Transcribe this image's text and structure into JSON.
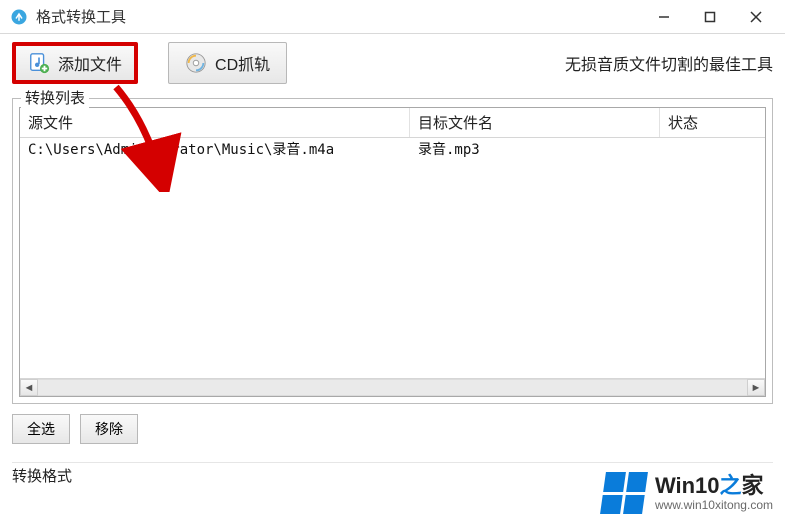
{
  "titlebar": {
    "title": "格式转换工具"
  },
  "toolbar": {
    "add_file_label": "添加文件",
    "cd_rip_label": "CD抓轨",
    "slogan": "无损音质文件切割的最佳工具"
  },
  "group": {
    "legend": "转换列表",
    "columns": {
      "source": "源文件",
      "target": "目标文件名",
      "status": "状态"
    }
  },
  "rows": [
    {
      "source": "C:\\Users\\Administrator\\Music\\录音.m4a",
      "target": "录音.mp3",
      "status": ""
    }
  ],
  "buttons": {
    "select_all": "全选",
    "remove": "移除"
  },
  "footer": {
    "label": "转换格式"
  },
  "watermark": {
    "brand_prefix": "Win10",
    "brand_mid": "之",
    "brand_suffix": "家",
    "url": "www.win10xitong.com"
  }
}
